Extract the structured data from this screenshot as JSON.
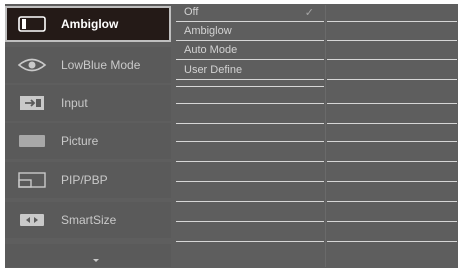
{
  "menu": {
    "items": [
      {
        "label": "Ambiglow",
        "icon": "ambiglow-icon",
        "active": true
      },
      {
        "label": "LowBlue Mode",
        "icon": "eye-icon",
        "active": false
      },
      {
        "label": "Input",
        "icon": "input-icon",
        "active": false
      },
      {
        "label": "Picture",
        "icon": "picture-icon",
        "active": false
      },
      {
        "label": "PIP/PBP",
        "icon": "pip-pbp-icon",
        "active": false
      },
      {
        "label": "SmartSize",
        "icon": "smartsize-icon",
        "active": false
      }
    ],
    "scroll_icon": "chevron-down-icon"
  },
  "submenu": {
    "options": [
      {
        "label": "Off",
        "selected": true
      },
      {
        "label": "Ambiglow",
        "selected": false
      },
      {
        "label": "Auto Mode",
        "selected": false
      },
      {
        "label": "User Define",
        "selected": false
      }
    ],
    "check_glyph": "✓"
  },
  "colors": {
    "osd_background": "#5e5e5e",
    "active_item_background": "#241a17",
    "active_item_border": "#bfbfbf",
    "text": "#c9c9c9",
    "divider": "#d6d6d6"
  }
}
